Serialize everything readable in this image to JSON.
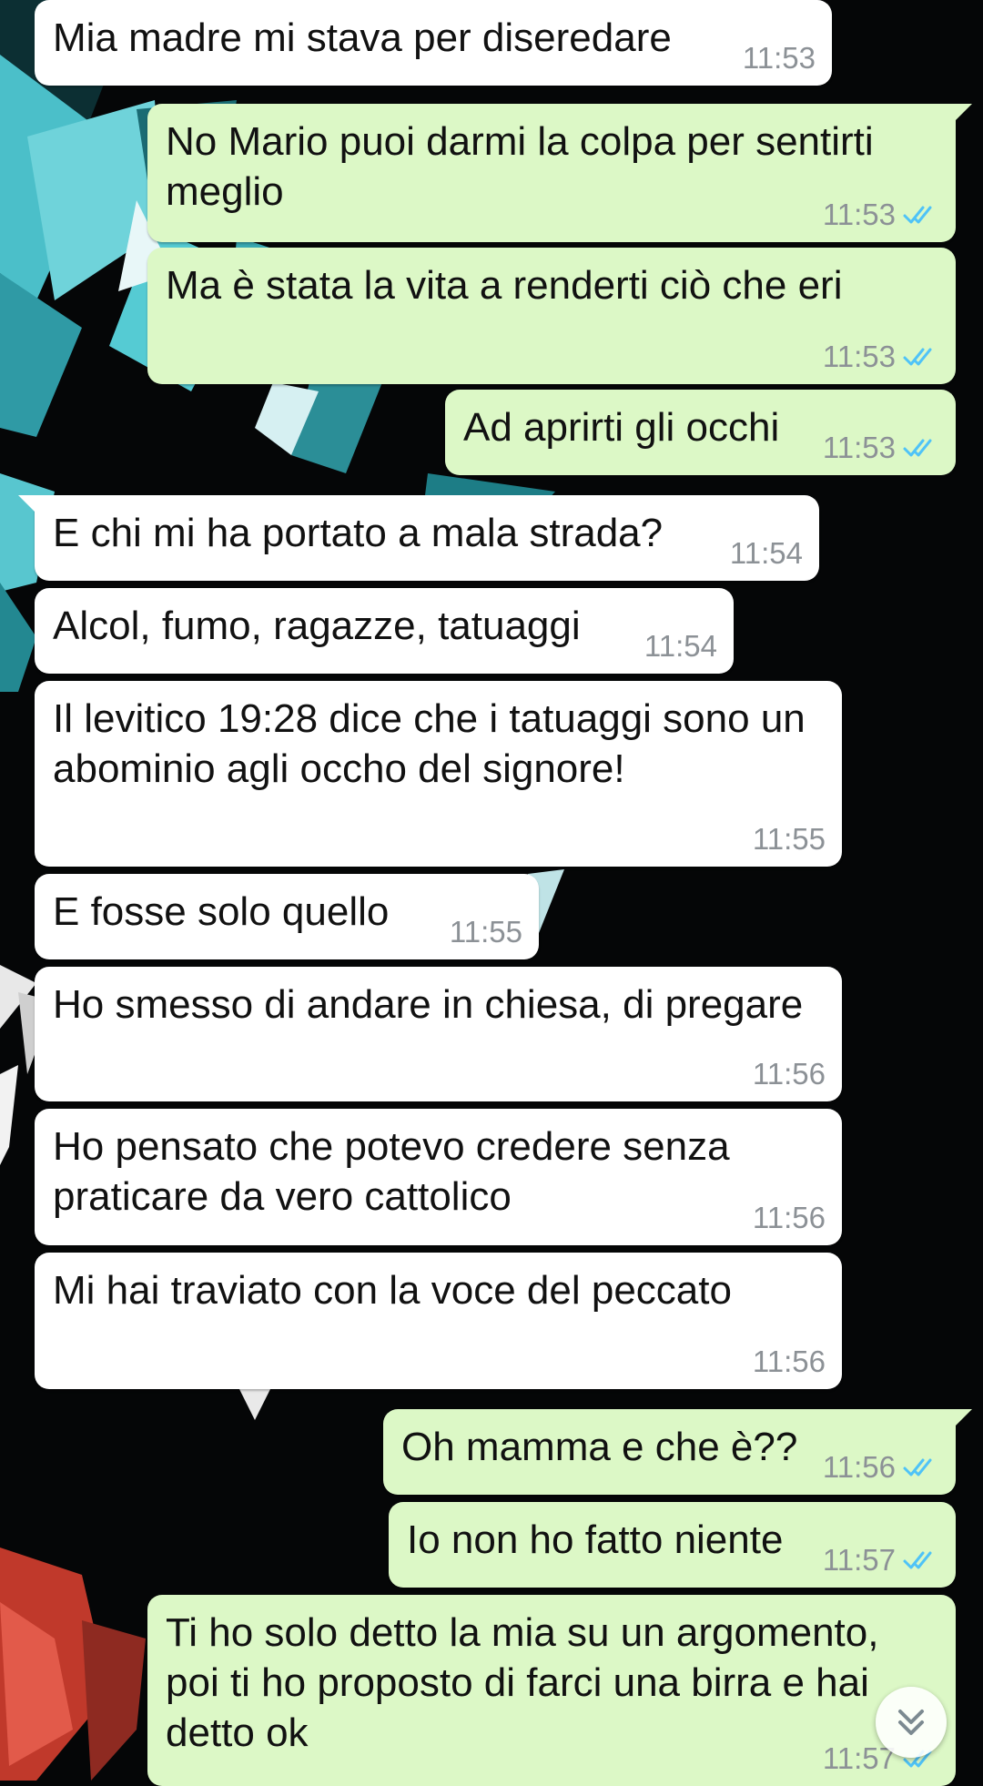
{
  "colors": {
    "incoming_bubble": "#ffffff",
    "outgoing_bubble": "#dcf8c6",
    "read_ticks": "#4fc3f7",
    "timestamp": "#8c9196"
  },
  "icons": {
    "read_receipt": "double-check-icon",
    "scroll": "double-chevron-down-icon"
  },
  "messages": [
    {
      "id": 0,
      "direction": "in",
      "text": "Mia madre mi stava per diseredare",
      "time": "11:53"
    },
    {
      "id": 1,
      "direction": "out",
      "text": "No Mario puoi darmi la colpa per sentirti meglio",
      "time": "11:53",
      "read": true
    },
    {
      "id": 2,
      "direction": "out",
      "text": "Ma è stata la vita a renderti ciò che eri",
      "time": "11:53",
      "read": true
    },
    {
      "id": 3,
      "direction": "out",
      "text": "Ad aprirti gli occhi",
      "time": "11:53",
      "read": true
    },
    {
      "id": 4,
      "direction": "in",
      "text": "E chi mi ha portato a mala strada?",
      "time": "11:54"
    },
    {
      "id": 5,
      "direction": "in",
      "text": "Alcol, fumo, ragazze, tatuaggi",
      "time": "11:54"
    },
    {
      "id": 6,
      "direction": "in",
      "text": "Il levitico 19:28 dice che i tatuaggi sono un abominio agli occho del signore!",
      "time": "11:55"
    },
    {
      "id": 7,
      "direction": "in",
      "text": "E fosse solo quello",
      "time": "11:55"
    },
    {
      "id": 8,
      "direction": "in",
      "text": "Ho smesso di andare in chiesa, di pregare",
      "time": "11:56"
    },
    {
      "id": 9,
      "direction": "in",
      "text": "Ho pensato che potevo credere senza praticare da vero cattolico",
      "time": "11:56"
    },
    {
      "id": 10,
      "direction": "in",
      "text": "Mi hai traviato con la voce del peccato",
      "time": "11:56"
    },
    {
      "id": 11,
      "direction": "out",
      "text": "Oh mamma e che è??",
      "time": "11:56",
      "read": true
    },
    {
      "id": 12,
      "direction": "out",
      "text": "Io non ho fatto niente",
      "time": "11:57",
      "read": true
    },
    {
      "id": 13,
      "direction": "out",
      "text": "Ti ho solo detto la mia su un argomento, poi ti ho proposto di farci una birra e hai detto ok",
      "time": "11:57",
      "read": true
    }
  ]
}
